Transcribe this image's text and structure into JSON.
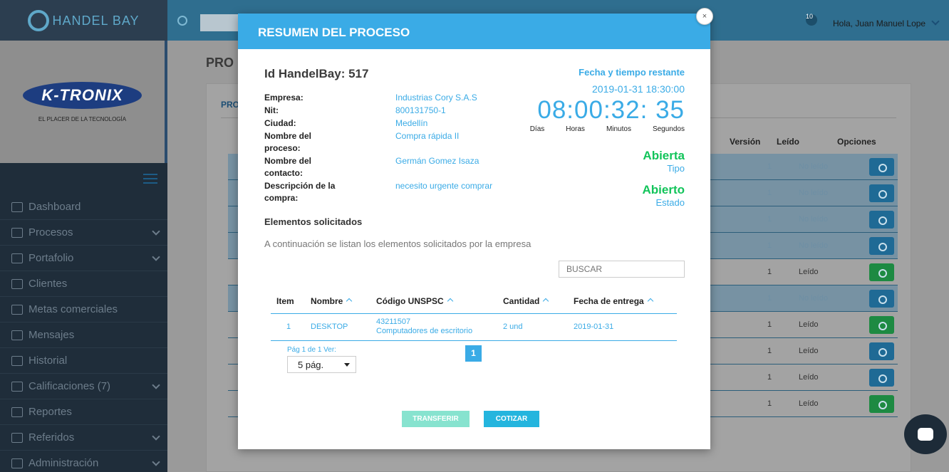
{
  "sidebar": {
    "logo_text": "HANDEL BAY",
    "brand_name": "K-TRONIX",
    "brand_tagline": "EL PLACER DE LA TECNOLOGÍA",
    "items": [
      {
        "label": "Dashboard",
        "icon": "home-icon",
        "has_children": false
      },
      {
        "label": "Procesos",
        "icon": "box-icon",
        "has_children": true
      },
      {
        "label": "Portafolio",
        "icon": "briefcase-icon",
        "has_children": true
      },
      {
        "label": "Clientes",
        "icon": "store-icon",
        "has_children": false
      },
      {
        "label": "Metas comerciales",
        "icon": "target-icon",
        "has_children": false
      },
      {
        "label": "Mensajes",
        "icon": "mail-icon",
        "has_children": false
      },
      {
        "label": "Historial",
        "icon": "folder-icon",
        "has_children": false
      },
      {
        "label": "Calificaciones (7)",
        "icon": "square-icon",
        "has_children": true
      },
      {
        "label": "Reportes",
        "icon": "box-icon",
        "has_children": false
      },
      {
        "label": "Referidos",
        "icon": "users-icon",
        "has_children": true
      },
      {
        "label": "Administración",
        "icon": "gear-icon",
        "has_children": true
      }
    ]
  },
  "topbar": {
    "notification_count": "10",
    "greeting": "Hola, Juan Manuel Lope"
  },
  "background": {
    "page_title": "PRO",
    "tab_label": "PRO",
    "columns": [
      "Versión",
      "Leído",
      "Opciones"
    ],
    "rows": [
      {
        "version": "1",
        "leido": "No leído",
        "option": "view",
        "shaded": true
      },
      {
        "version": "1",
        "leido": "No leído",
        "option": "view",
        "shaded": true
      },
      {
        "version": "1",
        "leido": "No leído",
        "option": "view",
        "shaded": true
      },
      {
        "version": "1",
        "leido": "No leído",
        "option": "view",
        "shaded": true
      },
      {
        "version": "1",
        "leido": "Leído",
        "option": "check",
        "shaded": false
      },
      {
        "version": "1",
        "leido": "No leído",
        "option": "view",
        "shaded": true
      },
      {
        "version": "1",
        "leido": "Leído",
        "option": "check",
        "shaded": false
      },
      {
        "version": "1",
        "leido": "Leído",
        "option": "view",
        "shaded": false
      },
      {
        "version": "1",
        "leido": "Leído",
        "option": "view",
        "shaded": false
      },
      {
        "version": "1",
        "leido": "Leído",
        "option": "check",
        "shaded": false
      }
    ]
  },
  "modal": {
    "title": "RESUMEN DEL PROCESO",
    "close_label": "×",
    "id_label": "Id HandelBay: 517",
    "info": [
      {
        "label": "Empresa:",
        "value": "Industrias Cory S.A.S"
      },
      {
        "label": "Nit:",
        "value": "800131750-1"
      },
      {
        "label": "Ciudad:",
        "value": "Medellín"
      },
      {
        "label": "Nombre del proceso:",
        "value": "Compra rápida II"
      },
      {
        "label": "Nombre del contacto:",
        "value": "Germán Gomez Isaza"
      },
      {
        "label": "Descripción de la compra:",
        "value": "necesito urgente comprar"
      }
    ],
    "fecha_title": "Fecha y tiempo restante",
    "fecha_value": "2019-01-31 18:30:00",
    "timer": "08:00:32: 35",
    "timer_labels": [
      "Días",
      "Horas",
      "Minutos",
      "Segundos"
    ],
    "tipo_value": "Abierta",
    "tipo_label": "Tipo",
    "estado_value": "Abierto",
    "estado_label": "Estado",
    "section_title": "Elementos solicitados",
    "section_desc": "A continuación se listan los elementos solicitados por la empresa",
    "search_placeholder": "BUSCAR",
    "table": {
      "headers": {
        "item": "Item",
        "nombre": "Nombre",
        "codigo": "Código UNSPSC",
        "cantidad": "Cantidad",
        "fecha": "Fecha de entrega"
      },
      "rows": [
        {
          "item": "1",
          "nombre": "DESKTOP",
          "codigo": "43211507",
          "codigo_desc": "Computadores de escritorio",
          "cantidad": "2 und",
          "fecha": "2019-01-31"
        }
      ]
    },
    "pager_label": "Pág 1 de 1 Ver:",
    "pager_select": "5 pág.",
    "current_page": "1",
    "transfer_label": "TRANSFERIR",
    "cotizar_label": "COTIZAR"
  },
  "colors": {
    "accent": "#3aabe6",
    "success": "#12c45a",
    "sidebar_bg": "#1f2d3a"
  }
}
